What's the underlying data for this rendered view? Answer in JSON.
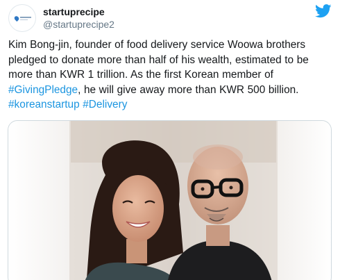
{
  "tweet": {
    "display_name": "startuprecipe",
    "handle": "@startuprecipe2",
    "text_before_1": "Kim Bong-jin, founder of food delivery service Woowa brothers pledged to donate more than half of his wealth, estimated to be more than KWR 1 trillion. As the first Korean member of ",
    "hashtag_1": "#GivingPledge",
    "text_after_1": ", he will give away more than KWR 500 billion. ",
    "hashtag_2": "#koreanstartup",
    "text_between": " ",
    "hashtag_3": "#Delivery"
  },
  "icons": {
    "brand": "twitter-bird-icon",
    "avatar": "startuprecipe-logo"
  },
  "colors": {
    "twitter_blue": "#1da1f2",
    "link": "#1b95e0",
    "handle_gray": "#657786"
  }
}
